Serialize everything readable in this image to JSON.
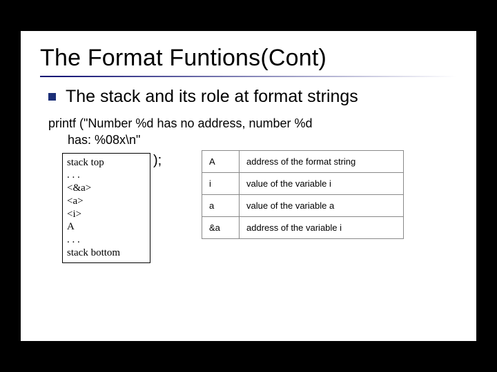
{
  "title": "The Format Funtions(Cont)",
  "bullet": "The stack and its role at format strings",
  "code": {
    "line1": "printf (\"Number %d has no address, number %d",
    "line2": "has: %08x\\n\"",
    "paren_frag": ");"
  },
  "stack": {
    "l0": "stack top",
    "l1": ". . .",
    "l2": "<&a>",
    "l3": "<a>",
    "l4": "<i>",
    "l5": "A",
    "l6": ". . .",
    "l7": "stack bottom"
  },
  "legend": {
    "rows": [
      {
        "k": "A",
        "v": "address of the format string"
      },
      {
        "k": "i",
        "v": "value of the variable i"
      },
      {
        "k": "a",
        "v": "value of the variable a"
      },
      {
        "k": "&a",
        "v": "address of the variable i"
      }
    ]
  }
}
